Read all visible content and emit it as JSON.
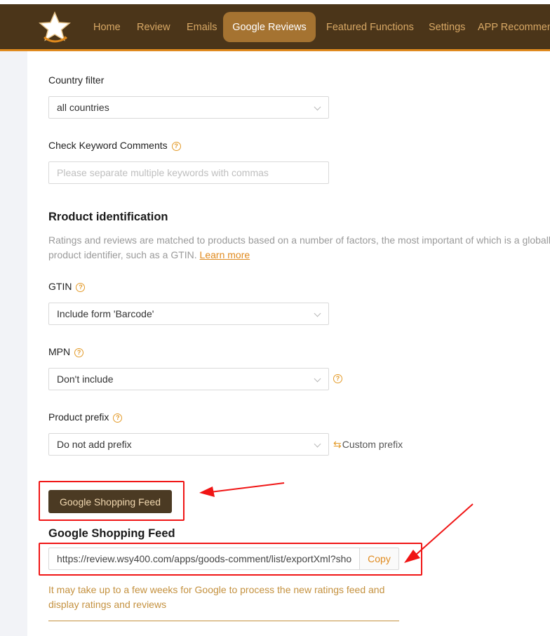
{
  "nav": {
    "items": [
      {
        "label": "Home",
        "active": false
      },
      {
        "label": "Review",
        "active": false
      },
      {
        "label": "Emails",
        "active": false
      },
      {
        "label": "Google Reviews",
        "active": true
      },
      {
        "label": "Featured Functions",
        "active": false
      },
      {
        "label": "Settings",
        "active": false
      },
      {
        "label": "APP Recommen",
        "active": false
      }
    ]
  },
  "country_filter": {
    "label": "Country filter",
    "value": "all countries"
  },
  "keyword_comments": {
    "label": "Check Keyword Comments",
    "placeholder": "Please separate multiple keywords with commas",
    "value": ""
  },
  "product_identification": {
    "title": "Rroduct identification",
    "description": "Ratings and reviews are matched to products based on a number of factors, the most important of which is a globall product identifier, such as a GTIN.",
    "learn_more": "Learn more"
  },
  "gtin": {
    "label": "GTIN",
    "value": "Include form 'Barcode'"
  },
  "mpn": {
    "label": "MPN",
    "value": "Don't include"
  },
  "product_prefix": {
    "label": "Product prefix",
    "value": "Do not add prefix",
    "custom_prefix": "Custom prefix"
  },
  "feed": {
    "button_label": "Google Shopping Feed",
    "title": "Google Shopping Feed",
    "url": "https://review.wsy400.com/apps/goods-comment/list/exportXml?sho",
    "copy_label": "Copy",
    "note": "It may take up to a few weeks for Google to process the new ratings feed and display ratings and reviews"
  },
  "colors": {
    "nav_bg": "#4b3519",
    "nav_active": "#a57331",
    "accent": "#e08a1e",
    "annotation": "#f01515"
  },
  "icons": [
    "star-logo-icon",
    "help-icon",
    "chevron-down-icon",
    "swap-icon",
    "annotation-arrow"
  ]
}
